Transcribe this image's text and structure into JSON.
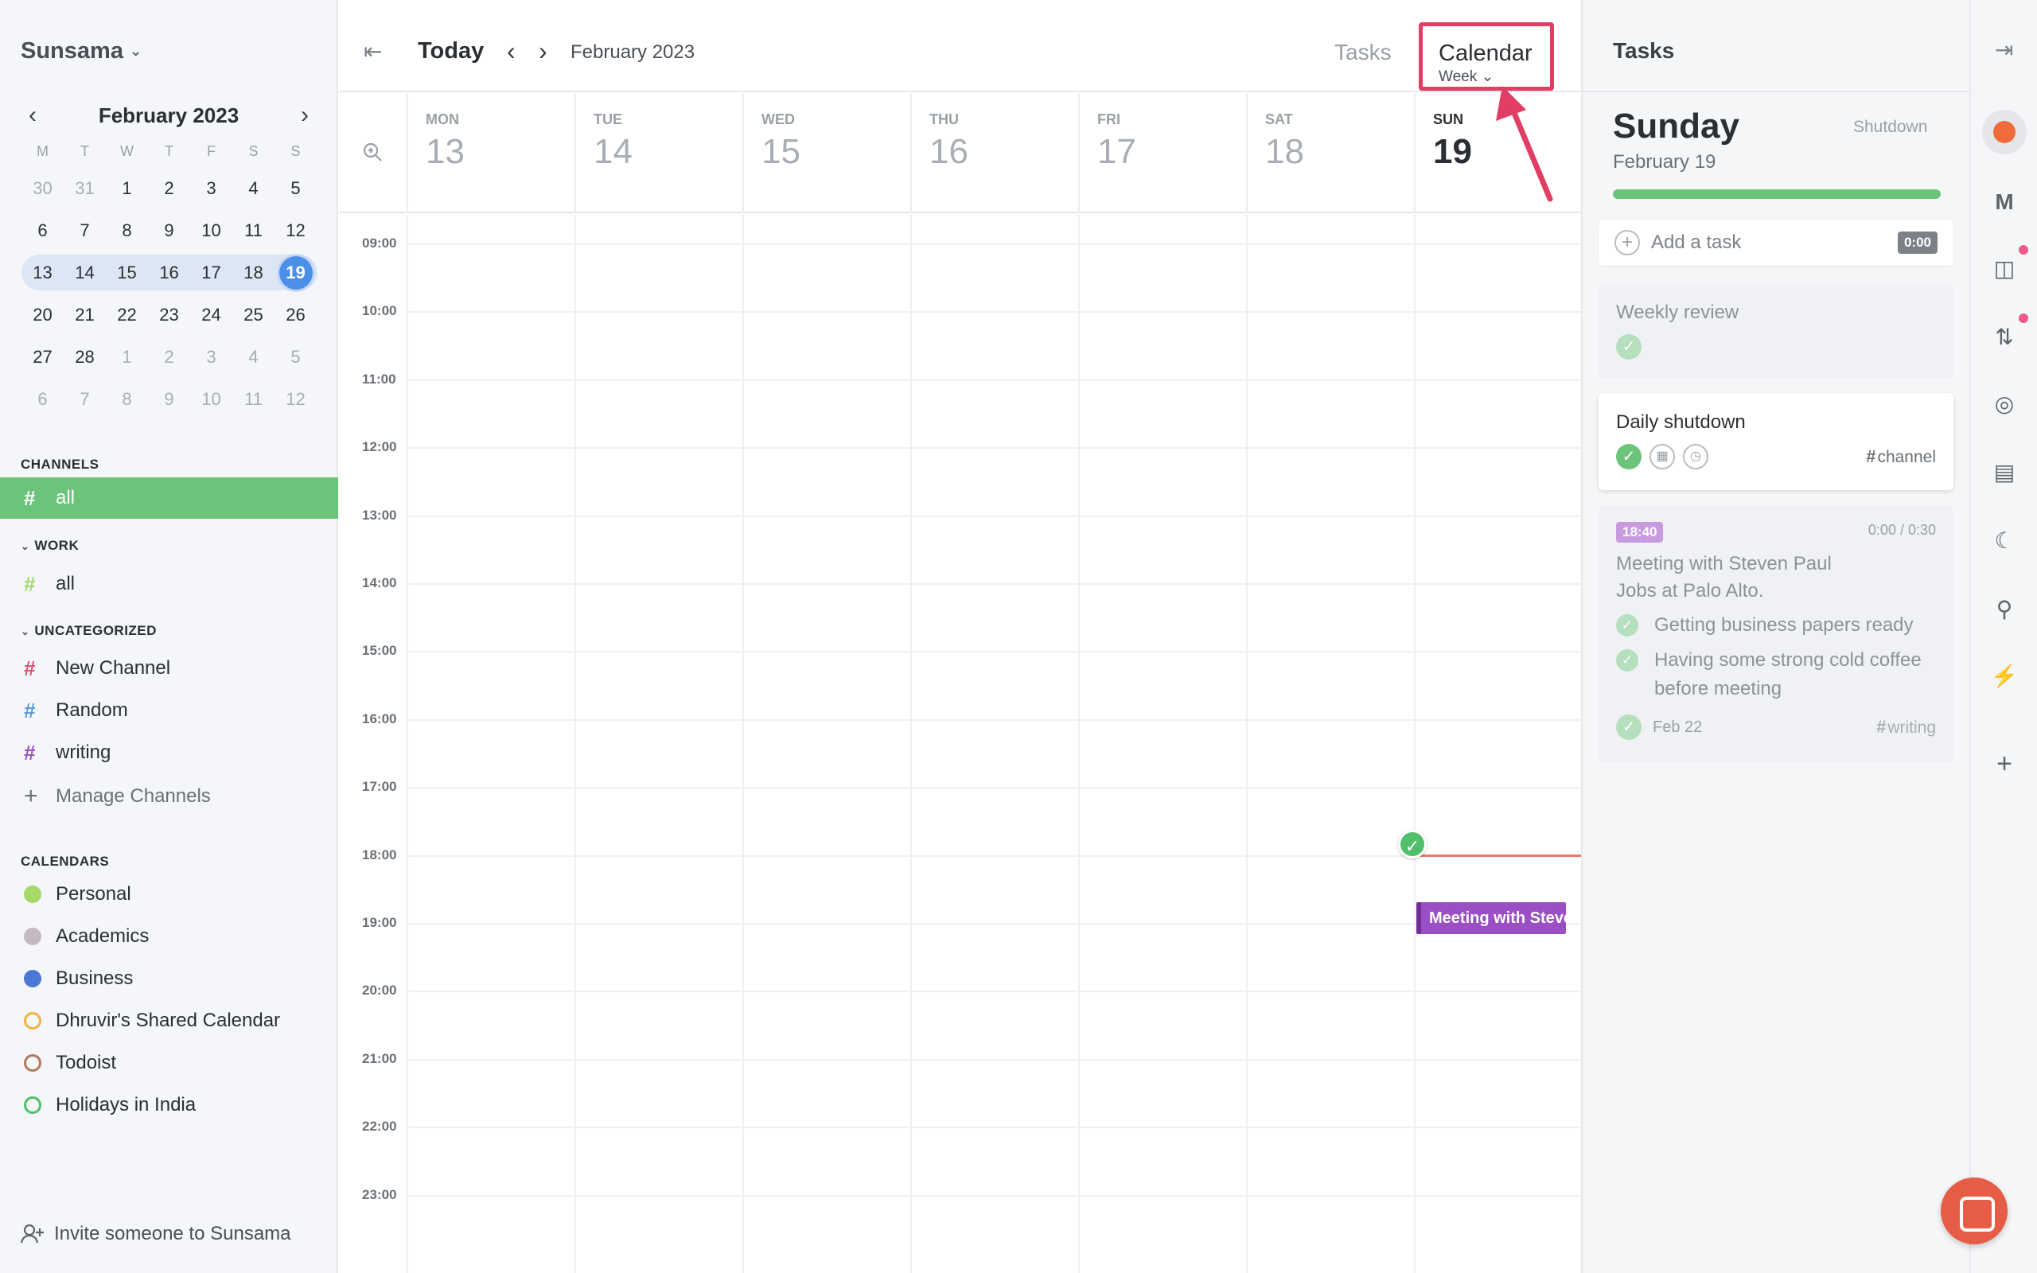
{
  "sidebar": {
    "workspace": "Sunsama",
    "mini_calendar": {
      "month": "February 2023",
      "dow": [
        "M",
        "T",
        "W",
        "T",
        "F",
        "S",
        "S"
      ],
      "weeks": [
        [
          {
            "d": "30",
            "m": true
          },
          {
            "d": "31",
            "m": true
          },
          {
            "d": "1"
          },
          {
            "d": "2"
          },
          {
            "d": "3"
          },
          {
            "d": "4"
          },
          {
            "d": "5"
          }
        ],
        [
          {
            "d": "6"
          },
          {
            "d": "7"
          },
          {
            "d": "8"
          },
          {
            "d": "9"
          },
          {
            "d": "10"
          },
          {
            "d": "11"
          },
          {
            "d": "12"
          }
        ],
        [
          {
            "d": "13"
          },
          {
            "d": "14"
          },
          {
            "d": "15"
          },
          {
            "d": "16"
          },
          {
            "d": "17"
          },
          {
            "d": "18"
          },
          {
            "d": "19",
            "sel": true
          }
        ],
        [
          {
            "d": "20"
          },
          {
            "d": "21"
          },
          {
            "d": "22"
          },
          {
            "d": "23"
          },
          {
            "d": "24"
          },
          {
            "d": "25"
          },
          {
            "d": "26"
          }
        ],
        [
          {
            "d": "27"
          },
          {
            "d": "28"
          },
          {
            "d": "1",
            "m": true
          },
          {
            "d": "2",
            "m": true
          },
          {
            "d": "3",
            "m": true
          },
          {
            "d": "4",
            "m": true
          },
          {
            "d": "5",
            "m": true
          }
        ],
        [
          {
            "d": "6",
            "m": true
          },
          {
            "d": "7",
            "m": true
          },
          {
            "d": "8",
            "m": true
          },
          {
            "d": "9",
            "m": true
          },
          {
            "d": "10",
            "m": true
          },
          {
            "d": "11",
            "m": true
          },
          {
            "d": "12",
            "m": true
          }
        ]
      ],
      "current_week_index": 2
    },
    "channels_title": "CHANNELS",
    "channels_all": "all",
    "work_title": "WORK",
    "work_all": "all",
    "uncategorized_title": "UNCATEGORIZED",
    "uncategorized": [
      {
        "label": "New Channel",
        "color": "#d9506f"
      },
      {
        "label": "Random",
        "color": "#5b9bd5"
      },
      {
        "label": "writing",
        "color": "#9b4fc4"
      }
    ],
    "manage_channels": "Manage Channels",
    "calendars_title": "CALENDARS",
    "calendars": [
      {
        "label": "Personal",
        "color": "#a6d86a",
        "filled": true
      },
      {
        "label": "Academics",
        "color": "#c6b8bf",
        "filled": true
      },
      {
        "label": "Business",
        "color": "#4a78d4",
        "filled": true
      },
      {
        "label": "Dhruvir's Shared Calendar",
        "color": "#f2b23d",
        "filled": false
      },
      {
        "label": "Todoist",
        "color": "#b27a5a",
        "filled": false
      },
      {
        "label": "Holidays in India",
        "color": "#4fbf6a",
        "filled": false
      }
    ],
    "invite": "Invite someone to Sunsama"
  },
  "topbar": {
    "today": "Today",
    "month": "February 2023",
    "tasks_tab": "Tasks",
    "calendar_tab": "Calendar",
    "view_mode": "Week"
  },
  "week": {
    "days": [
      {
        "dow": "MON",
        "num": "13"
      },
      {
        "dow": "TUE",
        "num": "14"
      },
      {
        "dow": "WED",
        "num": "15"
      },
      {
        "dow": "THU",
        "num": "16"
      },
      {
        "dow": "FRI",
        "num": "17"
      },
      {
        "dow": "SAT",
        "num": "18"
      },
      {
        "dow": "SUN",
        "num": "19",
        "today": true
      }
    ],
    "hours": [
      "09:00",
      "10:00",
      "11:00",
      "12:00",
      "13:00",
      "14:00",
      "15:00",
      "16:00",
      "17:00",
      "18:00",
      "19:00",
      "20:00",
      "21:00",
      "22:00",
      "23:00"
    ],
    "event": {
      "title": "Meeting with Steven Paul Jobs at Palo Alto.",
      "color": "#9b4fc4"
    }
  },
  "tasks_panel": {
    "title": "Tasks",
    "day": "Sunday",
    "date": "February 19",
    "shutdown": "Shutdown",
    "progress_pct": 100,
    "add_task": "Add a task",
    "add_task_time": "0:00",
    "weekly_review": "Weekly review",
    "daily_shutdown": "Daily shutdown",
    "daily_shutdown_tag": "channel",
    "meeting": {
      "time": "18:40",
      "duration": "0:00 / 0:30",
      "title": "Meeting with Steven Paul Jobs at Palo Alto.",
      "subtasks": [
        "Getting business papers ready",
        "Having some strong cold coffee before meeting"
      ],
      "due": "Feb 22",
      "tag": "writing"
    }
  },
  "rail": {
    "icons": [
      "avatar",
      "gmail-icon",
      "trello-icon",
      "asana-icon",
      "focus-icon",
      "archive-icon",
      "moon-icon",
      "search-icon",
      "bolt-icon",
      "plus-icon"
    ]
  }
}
